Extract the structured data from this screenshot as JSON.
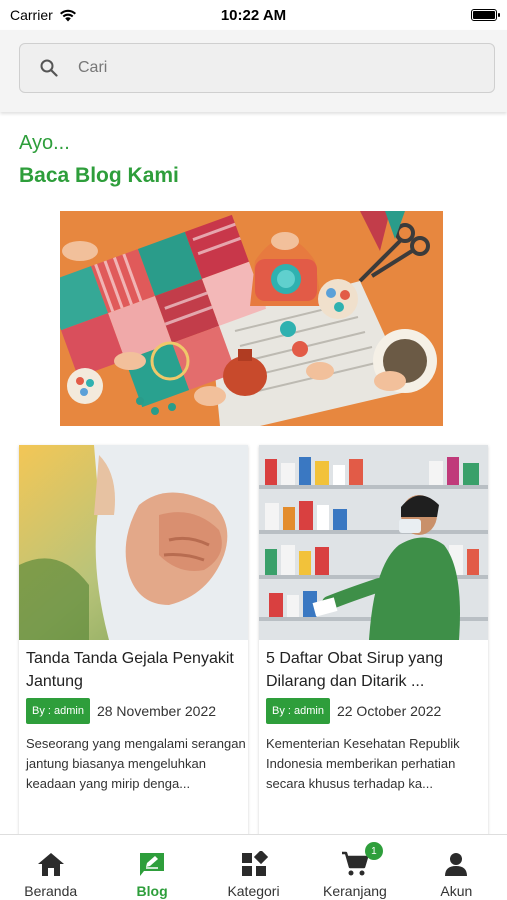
{
  "status_bar": {
    "carrier": "Carrier",
    "time": "10:22 AM"
  },
  "search": {
    "placeholder": "Cari"
  },
  "headline": {
    "small": "Ayo...",
    "big": "Baca Blog Kami"
  },
  "posts": [
    {
      "title": "Tanda Tanda Gejala Penyakit Jantung",
      "author_badge": "By : admin",
      "date": "28 November 2022",
      "excerpt": "Seseorang yang mengalami serangan jantung biasanya mengeluhkan keadaan yang mirip denga..."
    },
    {
      "title": "5 Daftar Obat Sirup yang Dilarang dan Ditarik ...",
      "author_badge": "By : admin",
      "date": "22 October 2022",
      "excerpt": "Kementerian Kesehatan Republik Indonesia memberikan perhatian secara khusus terhadap ka..."
    }
  ],
  "nav": {
    "items": [
      {
        "label": "Beranda",
        "icon": "home-icon"
      },
      {
        "label": "Blog",
        "icon": "blog-icon",
        "active": true
      },
      {
        "label": "Kategori",
        "icon": "category-icon"
      },
      {
        "label": "Keranjang",
        "icon": "cart-icon",
        "badge": "1"
      },
      {
        "label": "Akun",
        "icon": "account-icon"
      }
    ]
  },
  "colors": {
    "accent": "#2e9e3b",
    "hero_background": "#e7873f"
  }
}
